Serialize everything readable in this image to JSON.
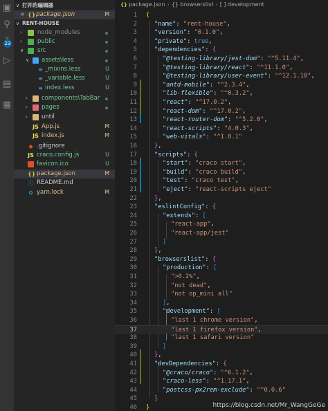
{
  "activity_bar": {
    "icons": [
      "files-icon",
      "search-icon",
      "source-control-icon",
      "run-debug-icon",
      "remote-explorer-icon",
      "extensions-icon"
    ],
    "scm_badge": "23"
  },
  "sidebar": {
    "open_editors_title": "打开的编辑器",
    "open_editor": {
      "name": "package.json",
      "status": "M"
    },
    "workspace_title": "RENT-HOUSE",
    "rows": [
      {
        "label": "node_modules",
        "status": ""
      },
      {
        "label": "public",
        "status": ""
      },
      {
        "label": "src",
        "status": ""
      },
      {
        "label": "assets\\less",
        "status": ""
      },
      {
        "label": "_mixins.less",
        "status": "U"
      },
      {
        "label": "_variable.less",
        "status": "U"
      },
      {
        "label": "index.less",
        "status": "U"
      },
      {
        "label": "components\\TabBar",
        "status": ""
      },
      {
        "label": "pages",
        "status": ""
      },
      {
        "label": "until",
        "status": ""
      },
      {
        "label": "App.js",
        "status": "M"
      },
      {
        "label": "index.js",
        "status": "M"
      },
      {
        "label": ".gitignore",
        "status": ""
      },
      {
        "label": "craco.config.js",
        "status": "U"
      },
      {
        "label": "favicon.ico",
        "status": "U"
      },
      {
        "label": "package.json",
        "status": "M"
      },
      {
        "label": "README.md",
        "status": ""
      },
      {
        "label": "yarn.lock",
        "status": "M"
      }
    ]
  },
  "breadcrumbs": {
    "file": "package.json",
    "middle": "{} browserslist",
    "last": "[ ] development"
  },
  "code": {
    "lines": [
      {
        "n": "1",
        "t": "{"
      },
      {
        "n": "2",
        "t": "\"name\": \"rent-house\","
      },
      {
        "n": "3",
        "t": "\"version\": \"0.1.0\","
      },
      {
        "n": "4",
        "t": "\"private\": true,"
      },
      {
        "n": "5",
        "t": "\"dependencies\": {"
      },
      {
        "n": "6",
        "t": "\"@testing-library/jest-dom\": \"^5.11.4\","
      },
      {
        "n": "7",
        "t": "\"@testing-library/react\": \"^11.1.0\","
      },
      {
        "n": "8",
        "t": "\"@testing-library/user-event\": \"^12.1.10\","
      },
      {
        "n": "9",
        "t": "\"antd-mobile\": \"^2.3.4\","
      },
      {
        "n": "10",
        "t": "\"lib-flexible\": \"^0.3.2\","
      },
      {
        "n": "11",
        "t": "\"react\": \"^17.0.2\","
      },
      {
        "n": "12",
        "t": "\"react-dom\": \"^17.0.2\","
      },
      {
        "n": "13",
        "t": "\"react-router-dom\": \"^5.2.0\","
      },
      {
        "n": "14",
        "t": "\"react-scripts\": \"4.0.3\","
      },
      {
        "n": "15",
        "t": "\"web-vitals\": \"^1.0.1\""
      },
      {
        "n": "16",
        "t": "},"
      },
      {
        "n": "17",
        "t": "\"scripts\": {"
      },
      {
        "n": "18",
        "t": "\"start\": \"craco start\","
      },
      {
        "n": "19",
        "t": "\"build\": \"craco build\","
      },
      {
        "n": "20",
        "t": "\"test\": \"craco test\","
      },
      {
        "n": "21",
        "t": "\"eject\": \"react-scripts eject\""
      },
      {
        "n": "22",
        "t": "},"
      },
      {
        "n": "23",
        "t": "\"eslintConfig\": {"
      },
      {
        "n": "24",
        "t": "\"extends\": ["
      },
      {
        "n": "25",
        "t": "\"react-app\","
      },
      {
        "n": "26",
        "t": "\"react-app/jest\""
      },
      {
        "n": "27",
        "t": "]"
      },
      {
        "n": "28",
        "t": "},"
      },
      {
        "n": "29",
        "t": "\"browserslist\": {"
      },
      {
        "n": "30",
        "t": "\"production\": ["
      },
      {
        "n": "31",
        "t": "\">0.2%\","
      },
      {
        "n": "32",
        "t": "\"not dead\","
      },
      {
        "n": "33",
        "t": "\"not op_mini all\""
      },
      {
        "n": "34",
        "t": "],"
      },
      {
        "n": "35",
        "t": "\"development\": ["
      },
      {
        "n": "36",
        "t": "\"last 1 chrome version\","
      },
      {
        "n": "37",
        "t": "\"last 1 firefox version\","
      },
      {
        "n": "38",
        "t": "\"last 1 safari version\""
      },
      {
        "n": "39",
        "t": "]"
      },
      {
        "n": "40",
        "t": "},"
      },
      {
        "n": "41",
        "t": "\"devDependencies\": {"
      },
      {
        "n": "42",
        "t": "\"@craco/craco\": \"^6.1.2\","
      },
      {
        "n": "43",
        "t": "\"craco-less\": \"^1.17.1\","
      },
      {
        "n": "44",
        "t": "\"postcss-px2rem-exclude\": \"^0.0.6\""
      },
      {
        "n": "45",
        "t": "}"
      },
      {
        "n": "46",
        "t": "}"
      }
    ]
  },
  "watermark": "https://blog.csdn.net/Mr_WangGeGe"
}
